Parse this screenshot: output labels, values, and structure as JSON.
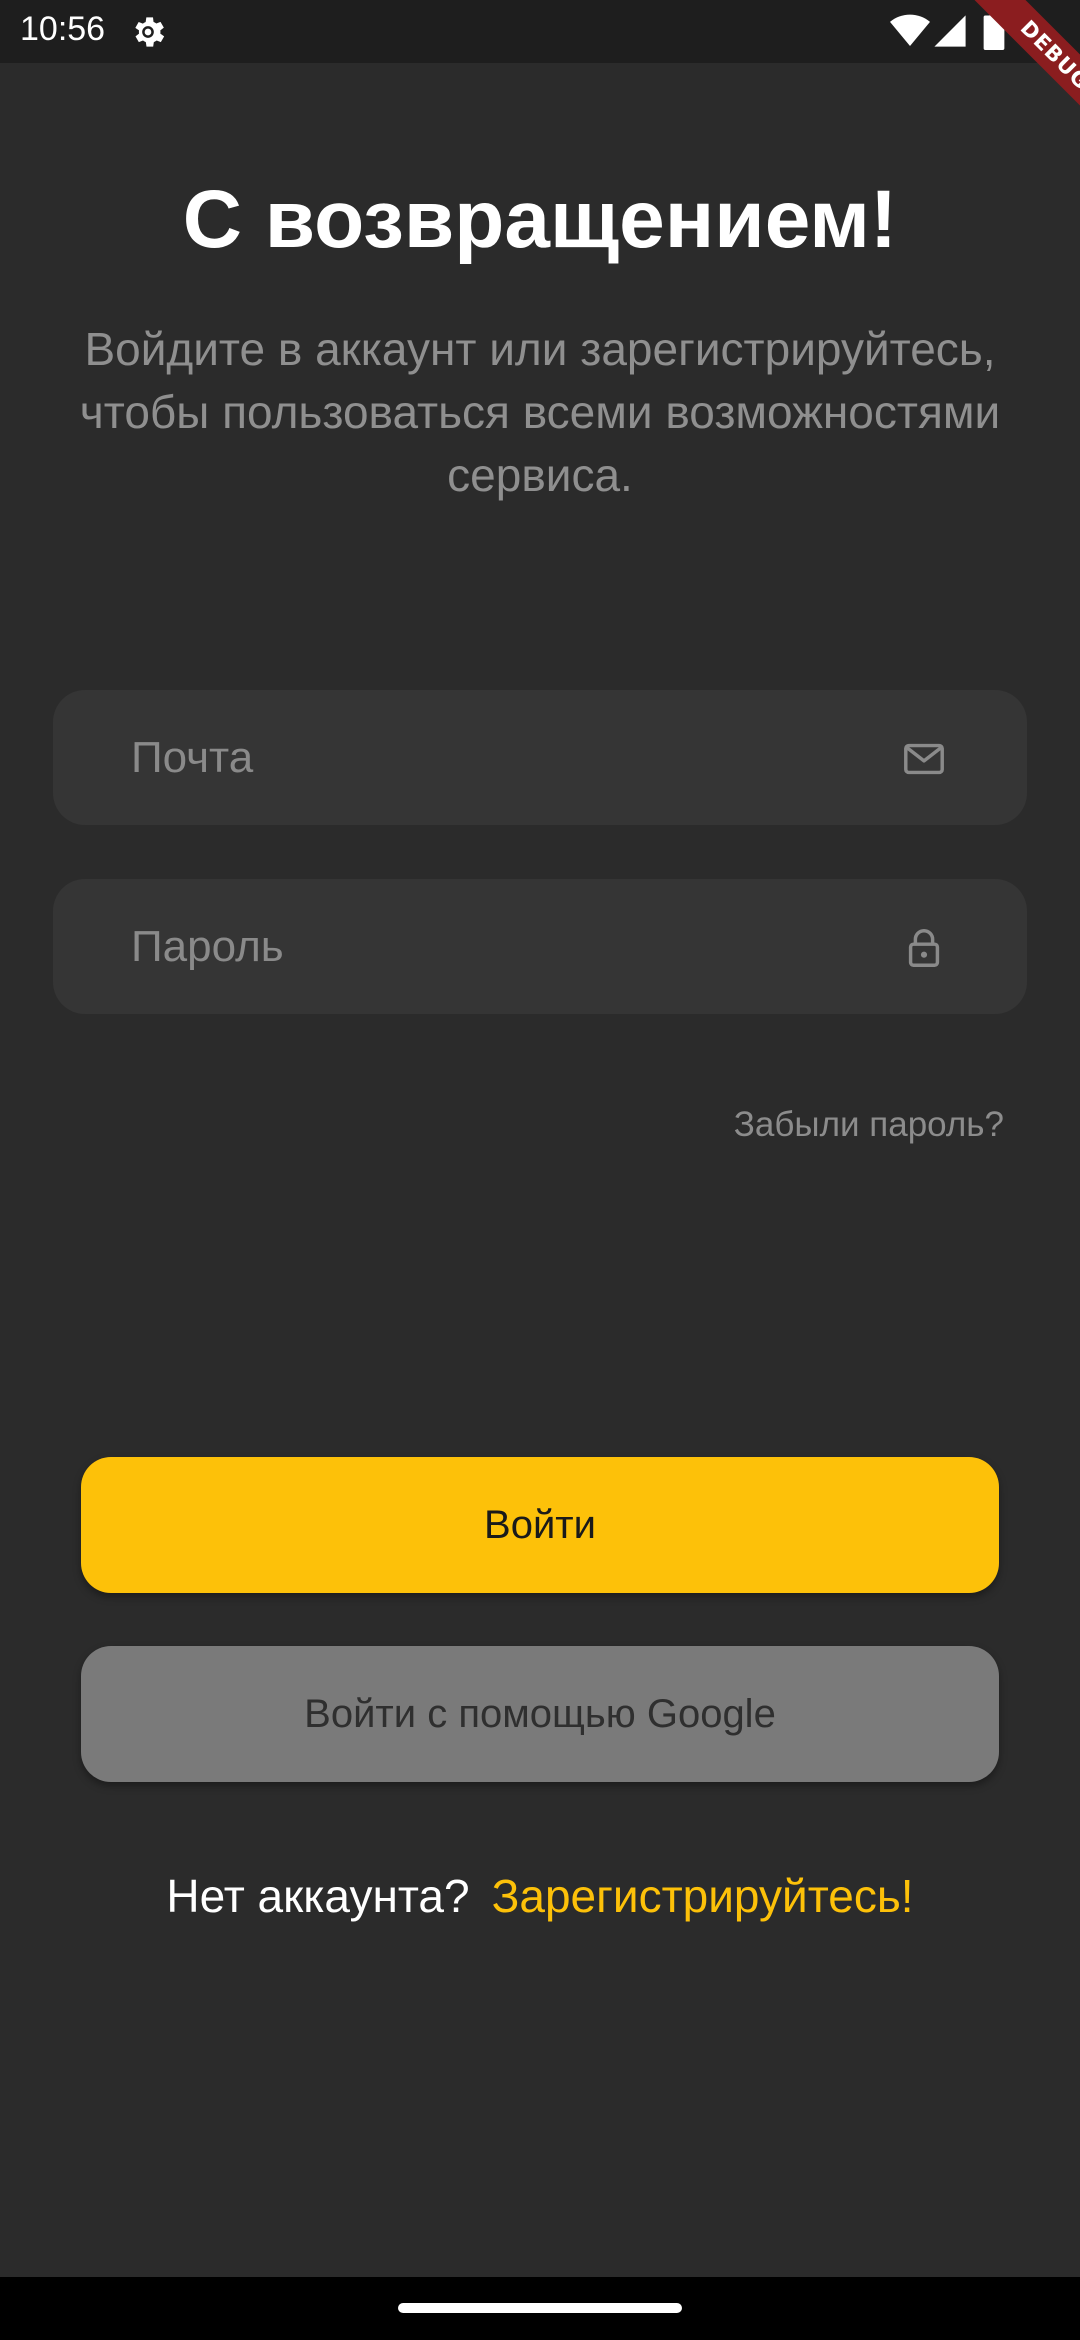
{
  "status_bar": {
    "time": "10:56",
    "icons": [
      "gear-icon",
      "wifi-icon",
      "signal-icon",
      "battery-icon"
    ]
  },
  "debug_banner": {
    "label": "DEBUG",
    "color": "#8b1d1f"
  },
  "login": {
    "title": "С возвращением!",
    "subtitle": "Войдите в аккаунт или зарегистрируйтесь, чтобы пользоваться всеми возможностями сервиса.",
    "email": {
      "placeholder": "Почта",
      "value": "",
      "icon": "mail-icon"
    },
    "password": {
      "placeholder": "Пароль",
      "value": "",
      "icon": "lock-icon"
    },
    "forgot_password_label": "Забыли пароль?",
    "login_button_label": "Войти",
    "google_button_label": "Войти с помощью Google",
    "no_account_prompt": "Нет аккаунта?",
    "signup_link_label": "Зарегистрируйтесь!"
  },
  "colors": {
    "background": "#2b2b2b",
    "field_background": "#353535",
    "accent": "#fdc109",
    "google_button": "#7a7a7a",
    "muted_text": "#8f8f8f"
  }
}
